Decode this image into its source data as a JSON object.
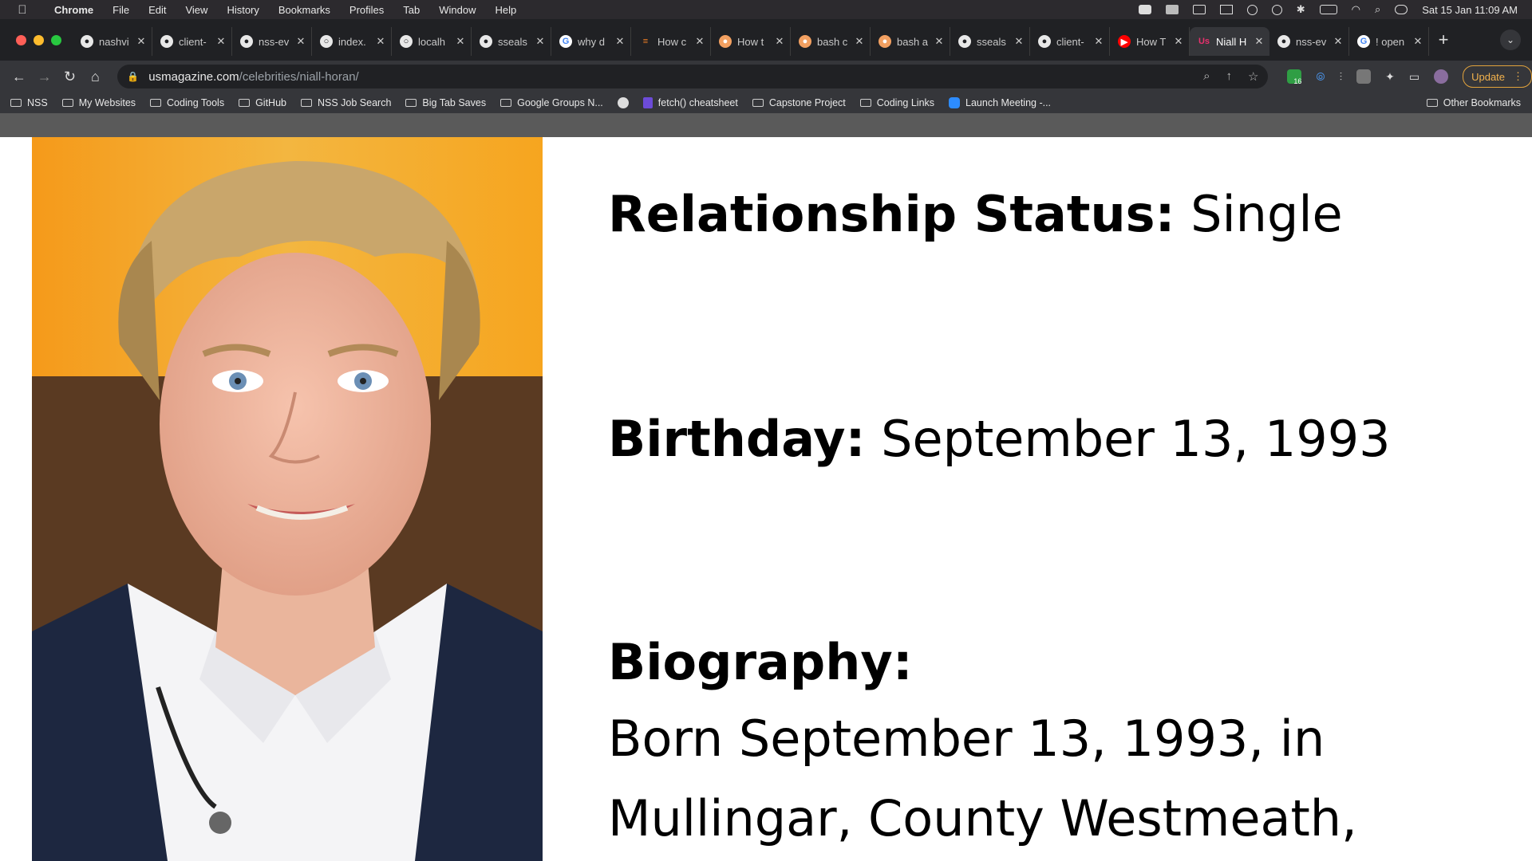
{
  "menubar": {
    "app": "Chrome",
    "items": [
      "File",
      "Edit",
      "View",
      "History",
      "Bookmarks",
      "Profiles",
      "Tab",
      "Window",
      "Help"
    ],
    "clock": "Sat 15 Jan  11:09 AM"
  },
  "tabs": [
    {
      "label": "nashvi",
      "icon": "github-icon"
    },
    {
      "label": "client-",
      "icon": "github-icon"
    },
    {
      "label": "nss-ev",
      "icon": "github-icon"
    },
    {
      "label": "index.",
      "icon": "globe-icon"
    },
    {
      "label": "localh",
      "icon": "globe-icon"
    },
    {
      "label": "sseals",
      "icon": "github-icon"
    },
    {
      "label": "why d",
      "icon": "google-icon"
    },
    {
      "label": "How c",
      "icon": "stackoverflow-icon"
    },
    {
      "label": "How t",
      "icon": "site-icon"
    },
    {
      "label": "bash c",
      "icon": "site-icon"
    },
    {
      "label": "bash a",
      "icon": "site-icon"
    },
    {
      "label": "sseals",
      "icon": "github-icon"
    },
    {
      "label": "client-",
      "icon": "github-icon"
    },
    {
      "label": "How T",
      "icon": "youtube-icon"
    },
    {
      "label": "Niall H",
      "icon": "usmagazine-icon",
      "active": true
    },
    {
      "label": "nss-ev",
      "icon": "github-icon"
    },
    {
      "label": "! open",
      "icon": "google-icon"
    }
  ],
  "address": {
    "domain": "usmagazine.com",
    "path": "/celebrities/niall-horan/"
  },
  "toolbar": {
    "update_label": "Update",
    "extension_badge": "16"
  },
  "bookmarks": [
    {
      "label": "NSS",
      "type": "folder"
    },
    {
      "label": "My Websites",
      "type": "folder"
    },
    {
      "label": "Coding Tools",
      "type": "folder"
    },
    {
      "label": "GitHub",
      "type": "folder"
    },
    {
      "label": "NSS Job Search",
      "type": "folder"
    },
    {
      "label": "Big Tab Saves",
      "type": "folder"
    },
    {
      "label": "Google Groups N...",
      "type": "folder"
    },
    {
      "label": "",
      "type": "globe"
    },
    {
      "label": "fetch() cheatsheet",
      "type": "link"
    },
    {
      "label": "Capstone Project",
      "type": "folder"
    },
    {
      "label": "Coding Links",
      "type": "folder"
    },
    {
      "label": "Launch Meeting -...",
      "type": "zoom"
    }
  ],
  "bookmarks_other": "Other Bookmarks",
  "profile": {
    "relationship_label": "Relationship Status:",
    "relationship_value": "Single",
    "birthday_label": "Birthday:",
    "birthday_value": "September 13, 1993",
    "biography_label": "Biography:",
    "biography_line1": "Born September 13, 1993, in",
    "biography_line2": "Mullingar, County Westmeath,"
  }
}
